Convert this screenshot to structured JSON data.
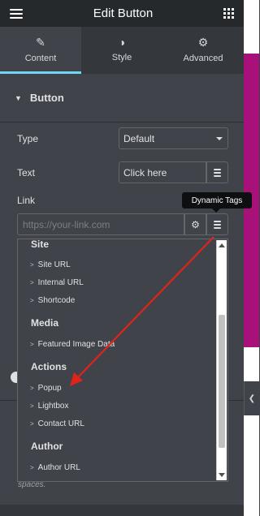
{
  "header": {
    "title": "Edit Button",
    "menu_icon": "hamburger-icon",
    "apps_icon": "grid-icon"
  },
  "tabs": [
    {
      "label": "Content",
      "icon": "pencil-icon",
      "active": true
    },
    {
      "label": "Style",
      "icon": "contrast-icon",
      "active": false
    },
    {
      "label": "Advanced",
      "icon": "gear-icon",
      "active": false
    }
  ],
  "section": {
    "title": "Button",
    "icon": "caret-down-icon"
  },
  "controls": {
    "type": {
      "label": "Type",
      "value": "Default"
    },
    "text": {
      "label": "Text",
      "value": "Click here"
    },
    "link": {
      "label": "Link",
      "placeholder": "https://your-link.com"
    }
  },
  "tooltip": {
    "text": "Dynamic Tags"
  },
  "dynamic_tags": {
    "groups": [
      {
        "name": "Site",
        "items": [
          "Site URL",
          "Internal URL",
          "Shortcode"
        ]
      },
      {
        "name": "Media",
        "items": [
          "Featured Image Data"
        ]
      },
      {
        "name": "Actions",
        "items": [
          "Popup",
          "Lightbox",
          "Contact URL"
        ]
      },
      {
        "name": "Author",
        "items": [
          "Author URL"
        ]
      }
    ]
  },
  "hint": {
    "text": "spaces."
  },
  "colors": {
    "panel_bg": "#404349",
    "topbar_bg": "#26292c",
    "tab_active_underline": "#71d7f7",
    "annotation_arrow": "#e2231a",
    "preview_accent": "#a8107a"
  }
}
